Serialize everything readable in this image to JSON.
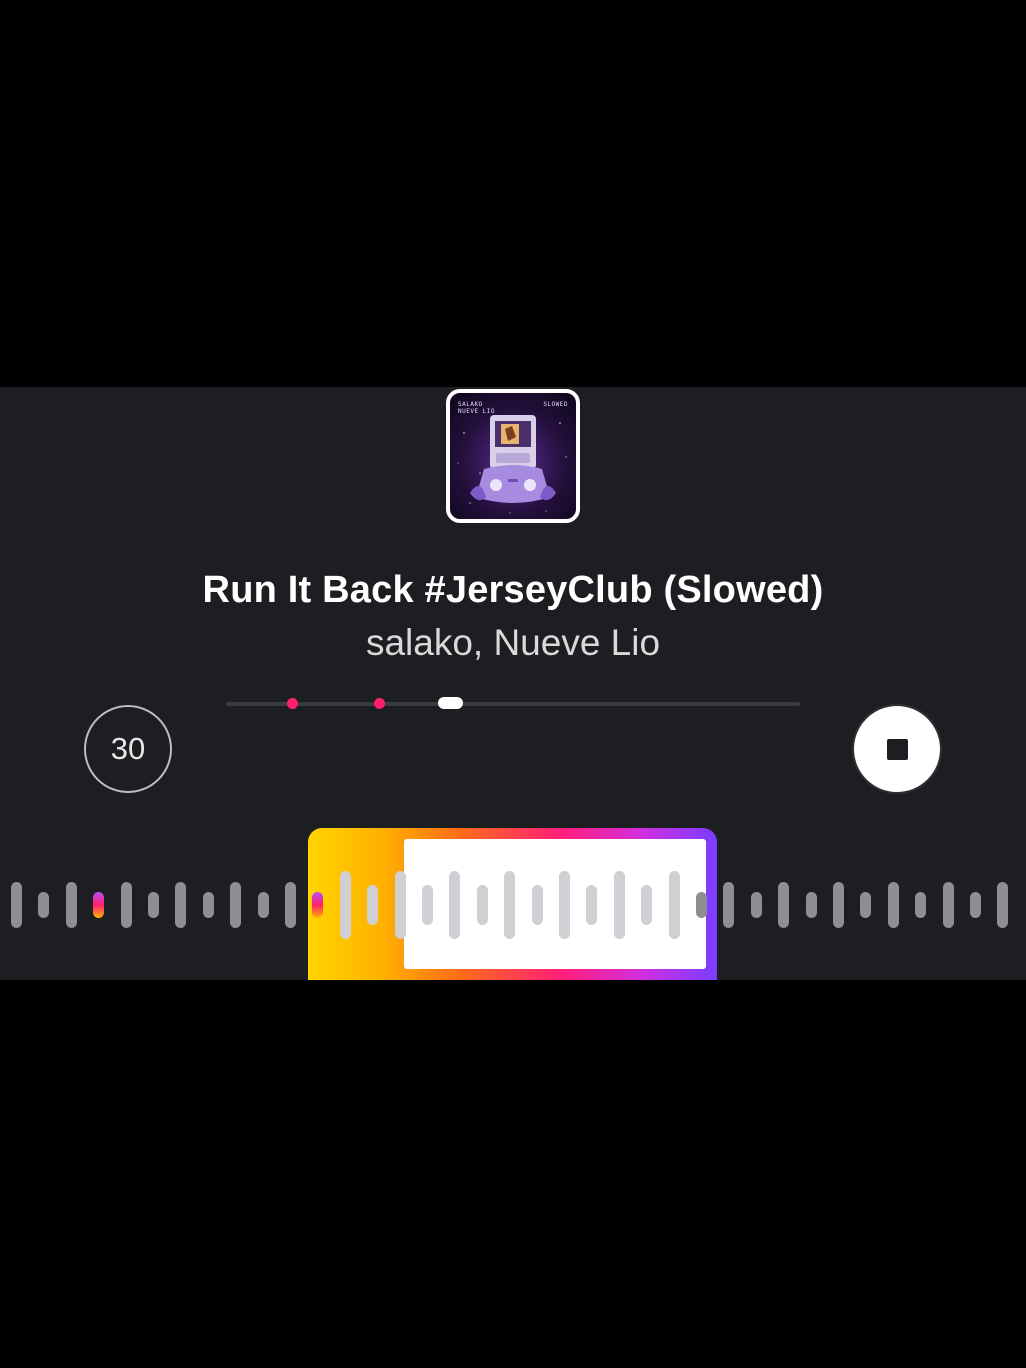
{
  "track": {
    "title": "Run It Back #JerseyClub (Slowed)",
    "artist": "salako, Nueve Lio",
    "cover_text_left": "SALAKO\nNUEVE LIO",
    "cover_text_right": "SLOWED"
  },
  "controls": {
    "timer_label": "30",
    "timer_icon": "timer-30-icon",
    "stop_icon": "stop-icon"
  },
  "progress": {
    "playhead_fraction": 0.39,
    "marker_fractions": [
      0.115,
      0.267
    ]
  },
  "clip_selector": {
    "label_icon": "waveform-clip-selector"
  },
  "colors": {
    "background": "#1d1e21",
    "marker": "#ff1f6b",
    "gradient_start": "#ffd400",
    "gradient_mid": "#ff1f7a",
    "gradient_end": "#7a3dff"
  }
}
